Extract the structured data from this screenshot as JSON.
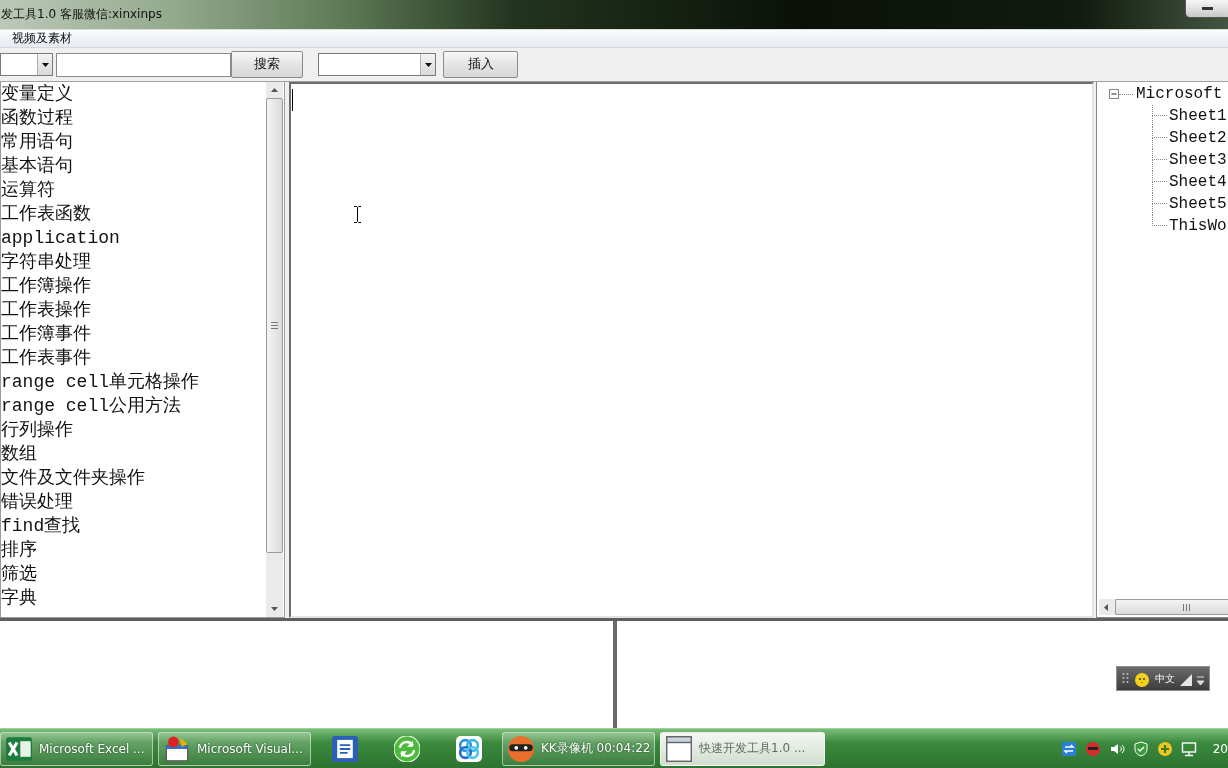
{
  "window": {
    "title": "发工具1.0 客服微信:xinxinps"
  },
  "menu": [
    "视频及素材"
  ],
  "toolbar": {
    "search_button": "搜索",
    "insert_button": "插入"
  },
  "function_list": {
    "items": [
      {
        "label": "变量定义",
        "selected": false
      },
      {
        "label": "函数过程",
        "selected": false
      },
      {
        "label": "常用语句",
        "selected": false
      },
      {
        "label": "基本语句",
        "selected": false
      },
      {
        "label": "运算符",
        "selected": false
      },
      {
        "label": "工作表函数",
        "selected": false
      },
      {
        "label": "application",
        "selected": false
      },
      {
        "label": "字符串处理",
        "selected": false
      },
      {
        "label": "工作簿操作",
        "selected": false
      },
      {
        "label": "工作表操作",
        "selected": false
      },
      {
        "label": "工作簿事件",
        "selected": false
      },
      {
        "label": "工作表事件",
        "selected": false
      },
      {
        "label": "range cell单元格操作",
        "selected": false
      },
      {
        "label": "range cell公用方法",
        "selected": false
      },
      {
        "label": "行列操作",
        "selected": false
      },
      {
        "label": "数组",
        "selected": false
      },
      {
        "label": "文件及文件夹操作",
        "selected": false
      },
      {
        "label": "错误处理",
        "selected": false
      },
      {
        "label": "find查找",
        "selected": false
      },
      {
        "label": "排序",
        "selected": false
      },
      {
        "label": "筛选",
        "selected": false
      },
      {
        "label": "字典",
        "selected": false
      }
    ]
  },
  "project_tree": {
    "root": {
      "label": "Microsoft",
      "expanded": true,
      "children": [
        {
          "label": "Sheet1"
        },
        {
          "label": "Sheet2"
        },
        {
          "label": "Sheet3"
        },
        {
          "label": "Sheet4"
        },
        {
          "label": "Sheet5"
        },
        {
          "label": "ThisWo"
        }
      ]
    }
  },
  "ime_bar": {
    "label": "中文"
  },
  "taskbar": {
    "items": [
      {
        "kind": "window",
        "label": "Microsoft Excel ...",
        "selected": false
      },
      {
        "kind": "window",
        "label": "Microsoft Visual...",
        "selected": false
      },
      {
        "kind": "pinned",
        "selected": false
      },
      {
        "kind": "pinned",
        "selected": false
      },
      {
        "kind": "pinned",
        "selected": false
      },
      {
        "kind": "window",
        "label": "KK录像机 00:04:22",
        "selected": false
      },
      {
        "kind": "window",
        "label": "快速开发工具1.0 ...",
        "selected": true
      }
    ],
    "clock": "20"
  }
}
